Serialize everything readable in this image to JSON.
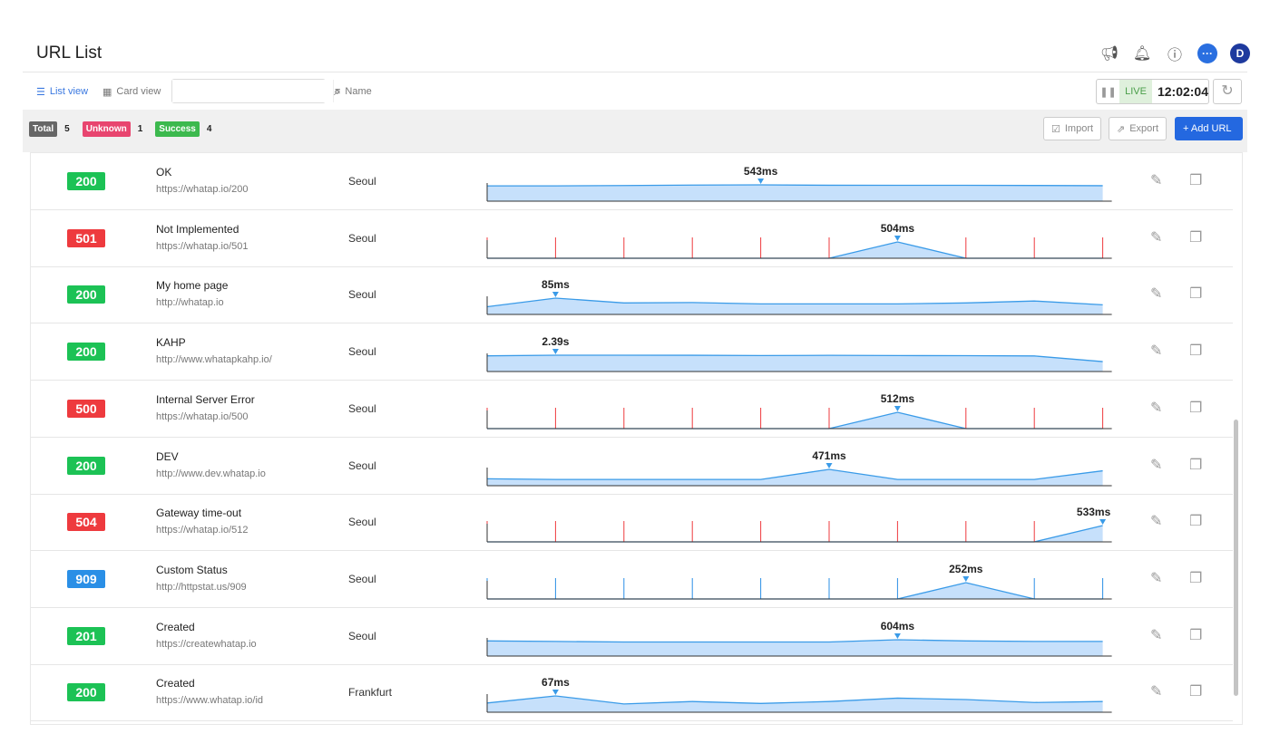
{
  "header": {
    "title": "URL List",
    "avatar": "D"
  },
  "toolbar": {
    "list_view": "List view",
    "card_view": "Card view",
    "search_placeholder": "",
    "sort": "Name",
    "live": "LIVE",
    "time": "12:02:04"
  },
  "summary": {
    "total_label": "Total",
    "total": "5",
    "unknown_label": "Unknown",
    "unknown": "1",
    "success_label": "Success",
    "success": "4"
  },
  "actions": {
    "import": "Import",
    "export": "Export",
    "add": "+ Add URL"
  },
  "colors": {
    "success": "#1cc255",
    "error": "#ee3a3e",
    "custom": "#2a8fe6",
    "line": "#3a9be8",
    "fill": "#c6e0fb"
  },
  "rows": [
    {
      "status": "200",
      "kind": "success",
      "name": "OK",
      "url": "https://whatap.io/200",
      "location": "Seoul",
      "peak_label": "543ms",
      "peak_index": 4,
      "values": [
        510,
        510,
        520,
        535,
        543,
        530,
        528,
        528,
        522,
        515
      ]
    },
    {
      "status": "501",
      "kind": "error",
      "name": "Not Implemented",
      "url": "https://whatap.io/501",
      "location": "Seoul",
      "peak_label": "504ms",
      "peak_index": 6,
      "values": [
        null,
        null,
        null,
        null,
        null,
        null,
        504,
        null,
        null,
        null
      ]
    },
    {
      "status": "200",
      "kind": "success",
      "name": "My home page",
      "url": "http://whatap.io",
      "location": "Seoul",
      "peak_label": "85ms",
      "peak_index": 1,
      "values": [
        40,
        85,
        60,
        62,
        55,
        55,
        55,
        60,
        70,
        50
      ]
    },
    {
      "status": "200",
      "kind": "success",
      "name": "KAHP",
      "url": "http://www.whatapkahp.io/",
      "location": "Seoul",
      "peak_label": "2.39s",
      "peak_index": 1,
      "values": [
        2300,
        2390,
        2390,
        2380,
        2340,
        2370,
        2340,
        2320,
        2280,
        1450
      ]
    },
    {
      "status": "500",
      "kind": "error",
      "name": "Internal Server Error",
      "url": "https://whatap.io/500",
      "location": "Seoul",
      "peak_label": "512ms",
      "peak_index": 6,
      "values": [
        null,
        null,
        null,
        null,
        null,
        null,
        512,
        null,
        null,
        null
      ]
    },
    {
      "status": "200",
      "kind": "success",
      "name": "DEV",
      "url": "http://www.dev.whatap.io",
      "location": "Seoul",
      "peak_label": "471ms",
      "peak_index": 5,
      "values": [
        200,
        180,
        180,
        180,
        180,
        471,
        180,
        180,
        180,
        430
      ]
    },
    {
      "status": "504",
      "kind": "error",
      "name": "Gateway time-out",
      "url": "https://whatap.io/512",
      "location": "Seoul",
      "peak_label": "533ms",
      "peak_index": 9,
      "values": [
        null,
        null,
        null,
        null,
        null,
        null,
        null,
        null,
        null,
        533
      ]
    },
    {
      "status": "909",
      "kind": "custom",
      "name": "Custom Status",
      "url": "http://httpstat.us/909",
      "location": "Seoul",
      "peak_label": "252ms",
      "peak_index": 7,
      "values": [
        null,
        null,
        null,
        null,
        null,
        null,
        null,
        252,
        null,
        null
      ]
    },
    {
      "status": "201",
      "kind": "success",
      "name": "Created",
      "url": "https://createwhatap.io",
      "location": "Seoul",
      "peak_label": "604ms",
      "peak_index": 6,
      "values": [
        560,
        540,
        520,
        520,
        520,
        520,
        604,
        560,
        540,
        540
      ]
    },
    {
      "status": "200",
      "kind": "success",
      "name": "Created",
      "url": "https://www.whatap.io/id",
      "location": "Frankfurt",
      "peak_label": "67ms",
      "peak_index": 1,
      "values": [
        38,
        67,
        34,
        44,
        36,
        44,
        58,
        52,
        40,
        44
      ]
    }
  ]
}
